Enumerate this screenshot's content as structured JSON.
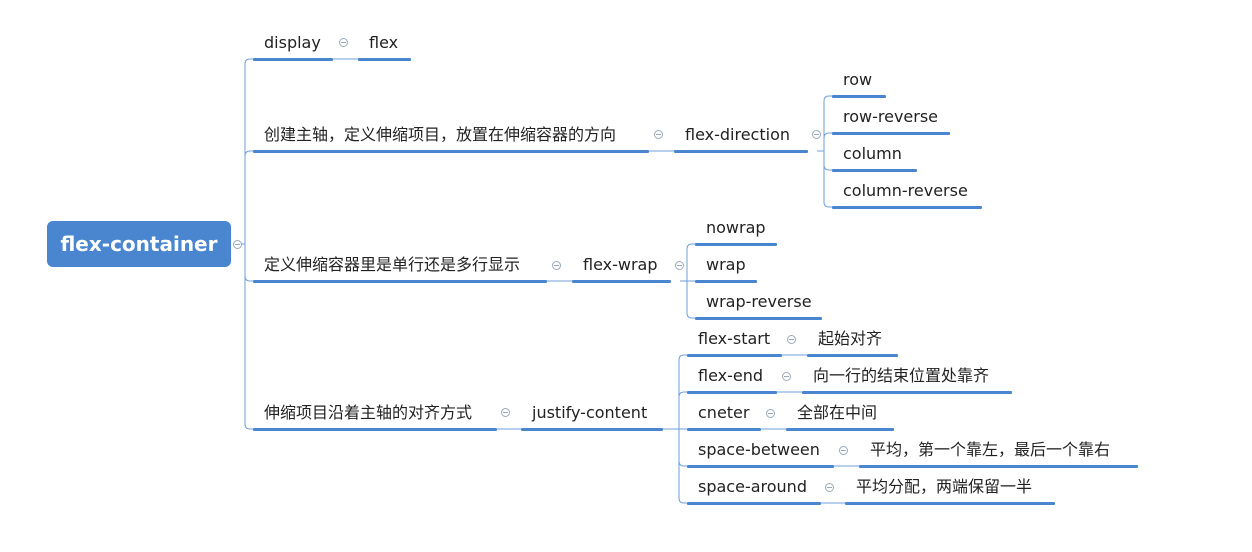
{
  "colors": {
    "accent": "#4a86cf",
    "connector": "#6f9fd8",
    "text": "#222222"
  },
  "root": {
    "label": "flex-container"
  },
  "branches": {
    "display": {
      "label": "display",
      "value": "flex"
    },
    "direction": {
      "label": "创建主轴，定义伸缩项目，放置在伸缩容器的方向",
      "property": "flex-direction",
      "values": [
        "row",
        "row-reverse",
        "column",
        "column-reverse"
      ]
    },
    "wrap": {
      "label": "定义伸缩容器里是单行还是多行显示",
      "property": "flex-wrap",
      "values": [
        "nowrap",
        "wrap",
        "wrap-reverse"
      ]
    },
    "justify": {
      "label": "伸缩项目沿着主轴的对齐方式",
      "property": "justify-content",
      "items": [
        {
          "value": "flex-start",
          "desc": "起始对齐"
        },
        {
          "value": "flex-end",
          "desc": "向一行的结束位置处靠齐"
        },
        {
          "value": "cneter",
          "desc": "全部在中间"
        },
        {
          "value": "space-between",
          "desc": "平均，第一个靠左，最后一个靠右"
        },
        {
          "value": "space-around",
          "desc": "平均分配，两端保留一半"
        }
      ]
    }
  }
}
